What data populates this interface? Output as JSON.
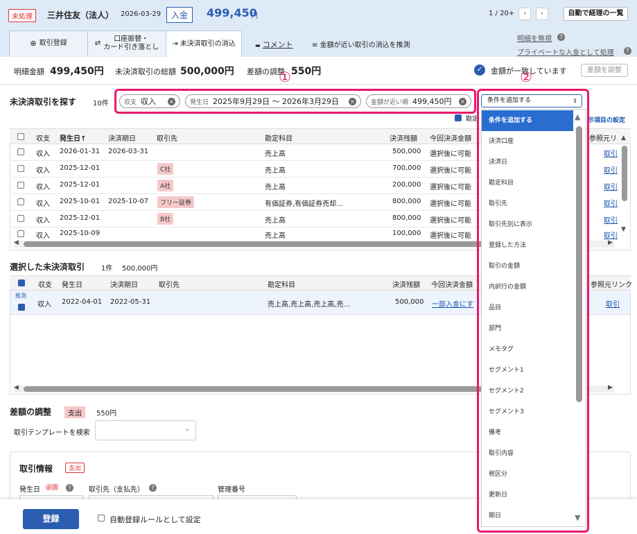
{
  "header": {
    "status_badge": "未処理",
    "company": "三井住友（法人）",
    "date": "2026-03-29",
    "type_badge": "入金",
    "amount": "499,450",
    "currency": "円",
    "pager": "1 / 20+",
    "prev": "‹",
    "next": "›",
    "auto_list_button": "自動で経理の一覧"
  },
  "tabs": [
    {
      "label": "取引登録",
      "icon": "⊕"
    },
    {
      "label": "口座振替・\nカード引き落とし",
      "icon": "⇄"
    },
    {
      "label": "未決済取引の消込",
      "icon": "⇥"
    },
    {
      "label": "コメント",
      "icon": "▬"
    },
    {
      "label": "金額が近い取引の消込を推測",
      "icon": "≡"
    }
  ],
  "links": {
    "ignore": "明細を無視",
    "private": "プライベートな入金として処理"
  },
  "summary": {
    "detail_label": "明細金額",
    "detail_value": "499,450円",
    "total_label": "未決済取引の総額",
    "total_value": "500,000円",
    "diff_label": "差額の調整",
    "diff_value": "550円",
    "match_text": "金額が一致しています",
    "adjust_button": "差額を調整"
  },
  "search": {
    "title": "未決済取引を探す",
    "count": "10件",
    "chips": [
      {
        "key": "収支",
        "value": "収入"
      },
      {
        "key": "発生日",
        "value": "2025年9月29日 〜 2026年3月29日"
      },
      {
        "key": "金額が近い順",
        "value": "499,450円"
      }
    ],
    "partial_check": "勘定",
    "partial_link": "示項目の設定"
  },
  "annotations": {
    "one": "①",
    "two": "②"
  },
  "table": {
    "headers": [
      "収支",
      "発生日↑",
      "決済期日",
      "取引先",
      "勘定科目",
      "決済残額",
      "今回決済金額",
      "参照元リ"
    ],
    "rows": [
      {
        "type": "収入",
        "date": "2026-01-31",
        "due": "2026-03-31",
        "partner": "",
        "account": "売上高",
        "balance": "500,000",
        "pay": "選択後に可能",
        "ref": "取引"
      },
      {
        "type": "収入",
        "date": "2025-12-01",
        "due": "",
        "partner": "C社",
        "account": "売上高",
        "balance": "700,000",
        "pay": "選択後に可能",
        "ref": "取引"
      },
      {
        "type": "収入",
        "date": "2025-12-01",
        "due": "",
        "partner": "A社",
        "account": "売上高",
        "balance": "200,000",
        "pay": "選択後に可能",
        "ref": "取引"
      },
      {
        "type": "収入",
        "date": "2025-10-01",
        "due": "2025-10-07",
        "partner": "フリー証券",
        "account": "有価証券,有価証券売却...",
        "balance": "800,000",
        "pay": "選択後に可能",
        "ref": "取引"
      },
      {
        "type": "収入",
        "date": "2025-12-01",
        "due": "",
        "partner": "B社",
        "account": "売上高",
        "balance": "800,000",
        "pay": "選択後に可能",
        "ref": "取引"
      },
      {
        "type": "収入",
        "date": "2025-10-09",
        "due": "",
        "partner": "",
        "account": "売上高",
        "balance": "100,000",
        "pay": "選択後に可能",
        "ref": "取引"
      }
    ]
  },
  "selected": {
    "title": "選択した未決済取引",
    "count": "1件",
    "amount": "500,000円",
    "headers": [
      "収支",
      "発生日",
      "決済期日",
      "取引先",
      "勘定科目",
      "決済残額",
      "今回決済金額",
      "参照元リンク"
    ],
    "row": {
      "tag": "推測",
      "type": "収入",
      "date": "2022-04-01",
      "due": "2022-05-31",
      "partner": "",
      "account": "売上高,売上高,売上高,売...",
      "balance": "500,000",
      "pay": "一部入金にす",
      "ref": "取引"
    }
  },
  "adjust": {
    "title": "差額の調整",
    "badge": "支出",
    "amount": "550円",
    "template_label": "取引テンプレートを検索"
  },
  "txinfo": {
    "title": "取引情報",
    "badge": "支出",
    "date_label": "発生日",
    "required": "必須",
    "partner_label": "取引先（支払先）",
    "mgmt_label": "管理番号"
  },
  "footer": {
    "register": "登録",
    "auto_rule": "自動登録ルールとして設定"
  },
  "dropdown": {
    "selected": "条件を追加する",
    "items": [
      "条件を追加する",
      "決済口座",
      "決済日",
      "勘定科目",
      "取引先",
      "取引先別に表示",
      "登録した方法",
      "取引の金額",
      "内訳行の金額",
      "品目",
      "部門",
      "メモタグ",
      "セグメント1",
      "セグメント2",
      "セグメント3",
      "備考",
      "取引内容",
      "税区分",
      "更新日",
      "期日"
    ]
  },
  "colors": {
    "accent": "#2a5db0",
    "highlight": "#e8196b",
    "header_bg": "#dfeaf7"
  }
}
